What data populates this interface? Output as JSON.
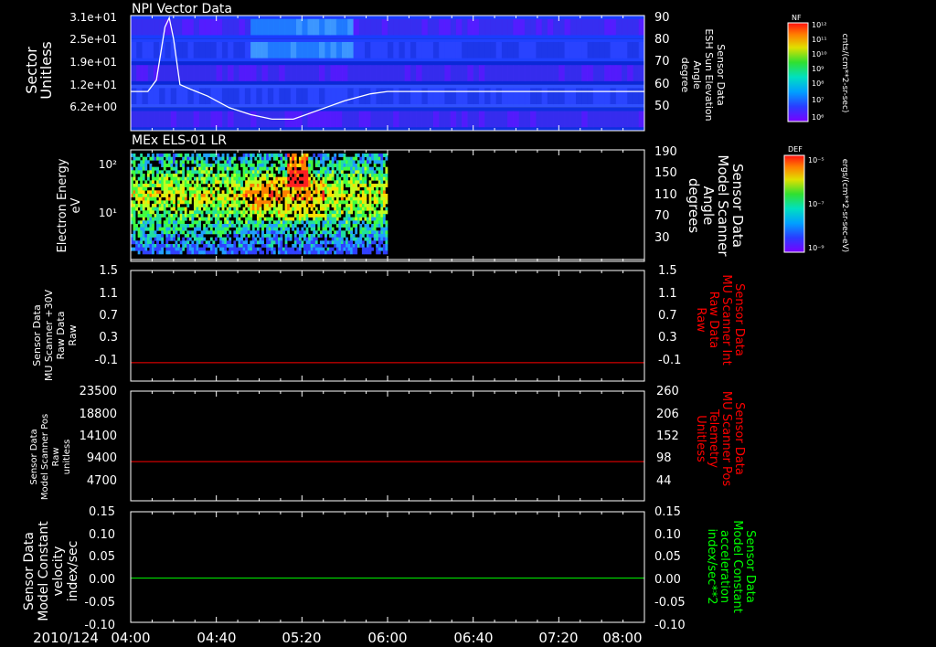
{
  "app": {
    "background": "#000000",
    "foreground": "#ffffff"
  },
  "time_axis": {
    "date_label": "2010/124",
    "ticks": [
      "04:00",
      "04:40",
      "05:20",
      "06:00",
      "06:40",
      "07:20",
      "08:00"
    ],
    "range_minutes": [
      240,
      480
    ]
  },
  "chart_data": [
    {
      "type": "heatmap",
      "title": "NPI Vector Data",
      "ylabel_left": [
        "Sector",
        "Unitless"
      ],
      "left_ticks": [
        "3.1e+01",
        "2.5e+01",
        "1.9e+01",
        "1.2e+01",
        "6.2e+00"
      ],
      "ylabel_right": [
        "Sensor Data",
        "ESH Sun Elevation",
        "Angle",
        "degree"
      ],
      "right_ticks": [
        "90",
        "80",
        "70",
        "60",
        "50"
      ],
      "right_range": [
        40,
        90
      ],
      "colorbar": {
        "label": "NF",
        "unit": "cnts/(cm**2-sr-sec)",
        "ticks": [
          "10¹²",
          "10¹¹",
          "10¹⁰",
          "10⁹",
          "10⁸",
          "10⁷",
          "10⁶"
        ]
      },
      "overlay_line": {
        "name": "ESH Sun Elevation Angle",
        "color": "#ffffff",
        "x": [
          240,
          248,
          252,
          256,
          258,
          260,
          263,
          268,
          276,
          286,
          296,
          306,
          316,
          328,
          340,
          352,
          360,
          480
        ],
        "y": [
          57,
          57,
          62,
          85,
          89,
          80,
          60,
          58,
          55,
          50,
          47,
          45,
          45,
          49,
          53,
          56,
          57,
          57
        ]
      }
    },
    {
      "type": "heatmap",
      "title": "MEx ELS-01 LR",
      "ylabel_left": [
        "Electron Energy",
        "eV"
      ],
      "left_ticks": [
        "10²",
        "10¹"
      ],
      "ylabel_right": [
        "Sensor Data",
        "Model Scanner",
        "Angle",
        "degrees"
      ],
      "right_ticks": [
        "190",
        "150",
        "110",
        "70",
        "30"
      ],
      "right_range": [
        10,
        190
      ],
      "colorbar": {
        "label": "DEF",
        "unit": "ergs/(cm**2-sr-sec-eV)",
        "ticks": [
          "10⁻⁵",
          "10⁻⁷",
          "10⁻⁹"
        ]
      },
      "data_end_minute": 360,
      "overlay_line": {
        "name": "Model Scanner Angle",
        "color": "#ffffff",
        "x": [
          240,
          480
        ],
        "y": [
          13,
          13
        ]
      }
    },
    {
      "type": "line",
      "ylabel_left": [
        "Sensor Data",
        "MU Scanner +30V",
        "Raw Data",
        "Raw"
      ],
      "left_ticks": [
        "1.5",
        "1.1",
        "0.7",
        "0.3",
        "-0.1"
      ],
      "left_range": [
        -0.3,
        1.5
      ],
      "ylabel_right": [
        "Sensor Data",
        "MU Scanner Int",
        "Raw Data",
        "Raw"
      ],
      "right_ticks": [
        "1.5",
        "1.1",
        "0.7",
        "0.3",
        "-0.1"
      ],
      "right_color": "#ff0000",
      "series": [
        {
          "color": "#ff0000",
          "x": [
            240,
            480
          ],
          "y": [
            0.0,
            0.0
          ]
        }
      ]
    },
    {
      "type": "line",
      "ylabel_left": [
        "Sensor Data",
        "Model Scanner Pos",
        "Raw",
        "unitless"
      ],
      "left_ticks": [
        "23500",
        "18800",
        "14100",
        "9400",
        "4700"
      ],
      "left_range": [
        0,
        23500
      ],
      "ylabel_right": [
        "Sensor Data",
        "MU Scanner Pos",
        "Telemetry",
        "Unitless"
      ],
      "right_ticks": [
        "260",
        "206",
        "152",
        "98",
        "44"
      ],
      "right_color": "#ff0000",
      "series": [
        {
          "color": "#ff0000",
          "x": [
            240,
            480
          ],
          "y": [
            8400,
            8400
          ]
        }
      ]
    },
    {
      "type": "line",
      "ylabel_left": [
        "Sensor Data",
        "Model Constant",
        "velocity",
        "index/sec"
      ],
      "left_ticks": [
        "0.15",
        "0.10",
        "0.05",
        "0.00",
        "-0.05",
        "-0.10"
      ],
      "left_range": [
        -0.1,
        0.15
      ],
      "right_ticks": [
        "0.15",
        "0.10",
        "0.05",
        "0.00",
        "-0.05",
        "-0.10"
      ],
      "ylabel_right": [
        "Sensor Data",
        "Model Constant",
        "acceleration",
        "index/sec**2"
      ],
      "right_color": "#00ff00",
      "series": [
        {
          "color": "#00ff00",
          "x": [
            240,
            480
          ],
          "y": [
            0.0,
            0.0
          ]
        }
      ]
    }
  ]
}
